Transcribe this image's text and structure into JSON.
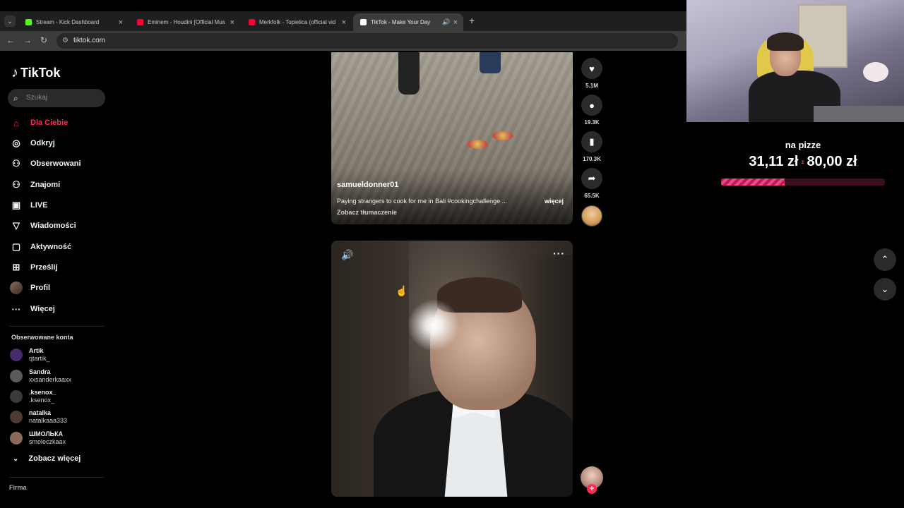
{
  "browser": {
    "tabs": [
      {
        "title": "Stream - Kick Dashboard",
        "favicon_color": "#53fc18"
      },
      {
        "title": "Eminem - Houdini [Official Mus",
        "favicon_color": "#ff0033"
      },
      {
        "title": "Merkfolk - Topielica (official vid",
        "favicon_color": "#ff0033"
      },
      {
        "title": "TikTok - Make Your Day",
        "favicon_color": "#ffffff"
      }
    ],
    "new_tab": "+",
    "url": "tiktok.com"
  },
  "sidebar": {
    "logo": "TikTok",
    "search_placeholder": "Szukaj",
    "nav": [
      {
        "label": "Dla Ciebie",
        "icon": "home-icon",
        "glyph": "⌂"
      },
      {
        "label": "Odkryj",
        "icon": "compass-icon",
        "glyph": "◎"
      },
      {
        "label": "Obserwowani",
        "icon": "following-icon",
        "glyph": "⚇"
      },
      {
        "label": "Znajomi",
        "icon": "friends-icon",
        "glyph": "⚇"
      },
      {
        "label": "LIVE",
        "icon": "live-icon",
        "glyph": "▣"
      },
      {
        "label": "Wiadomości",
        "icon": "messages-icon",
        "glyph": "▽"
      },
      {
        "label": "Aktywność",
        "icon": "activity-icon",
        "glyph": "▢"
      },
      {
        "label": "Prześlij",
        "icon": "upload-icon",
        "glyph": "⊞"
      },
      {
        "label": "Profil",
        "icon": "profile-icon",
        "glyph": ""
      },
      {
        "label": "Więcej",
        "icon": "more-icon",
        "glyph": "···"
      }
    ],
    "following_title": "Obserwowane konta",
    "accounts": [
      {
        "name": "Artik",
        "handle": "qtartik_",
        "color": "#4a2a6a"
      },
      {
        "name": "Sandra",
        "handle": "xxsanderkaaxx",
        "color": "#5a5a5a"
      },
      {
        "name": ".ksenox_",
        "handle": ".ksenox_",
        "color": "#3a3a3a"
      },
      {
        "name": "natalka",
        "handle": "natalkaaa333",
        "color": "#4d3a30"
      },
      {
        "name": "ШМОЛЬКА",
        "handle": "smoleczkaax",
        "color": "#8c6a58"
      }
    ],
    "see_more": "Zobacz więcej",
    "footer": "Firma"
  },
  "video1": {
    "username": "samueldonner01",
    "description": "Paying strangers to cook for me in Bali #cookingchallenge ...",
    "more": "więcej",
    "translate": "Zobacz tłumaczenie",
    "actions": [
      {
        "icon": "heart-icon",
        "glyph": "♥",
        "count": "5.1M"
      },
      {
        "icon": "comment-icon",
        "glyph": "●",
        "count": "19.3K"
      },
      {
        "icon": "bookmark-icon",
        "glyph": "▮",
        "count": "170.3K"
      },
      {
        "icon": "share-icon",
        "glyph": "➦",
        "count": "65.5K"
      }
    ]
  },
  "video2": {
    "sound_glyph": "🔊",
    "menu_glyph": "···",
    "follow_glyph": "+"
  },
  "scroll": {
    "up": "⌃",
    "down": "⌄"
  },
  "stream_goal": {
    "title": "na pizze",
    "current": "31,11 zł",
    "separator": "z",
    "target": "80,00 zł",
    "progress": 0.389
  }
}
